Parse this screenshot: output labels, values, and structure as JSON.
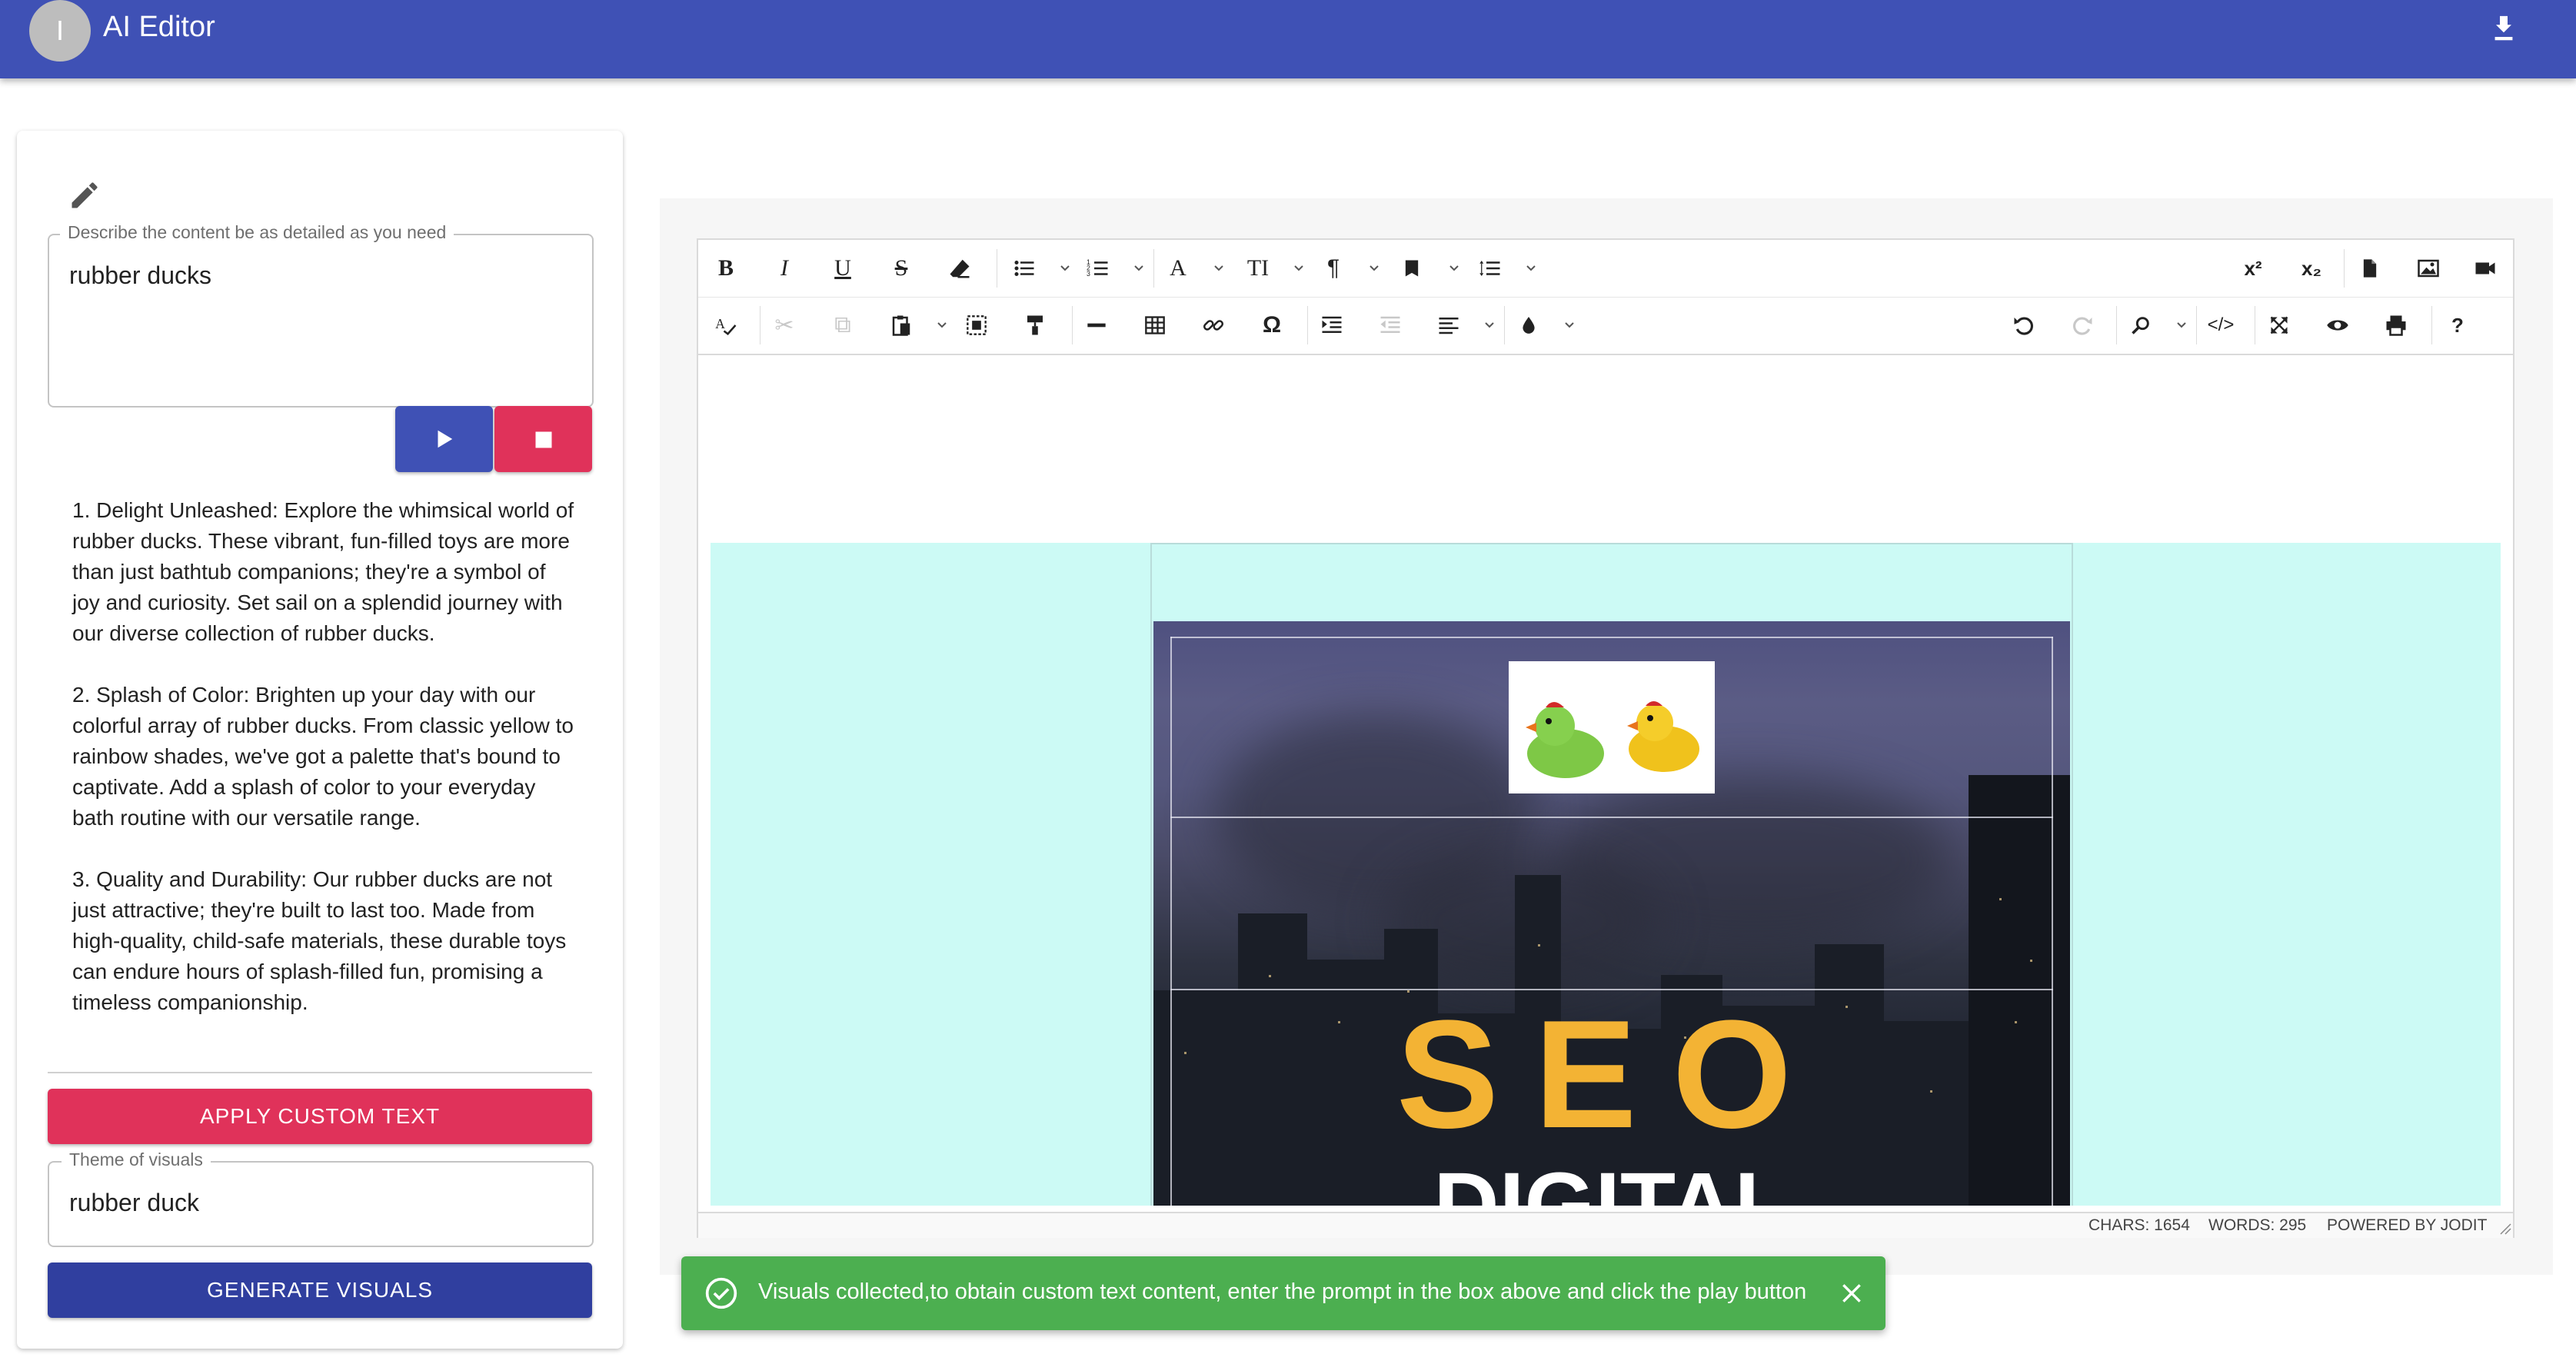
{
  "app": {
    "title": "AI Editor",
    "avatar_letter": "I",
    "download_icon": "download-icon"
  },
  "colors": {
    "appbar": "#3f51b5",
    "primary_button": "#303f9f",
    "danger_button": "#e0325a",
    "snackbar": "#4caf50",
    "editor_content_bg": "#ccfaf5",
    "seo_text": "#f3b334"
  },
  "prompt_field": {
    "label": "Describe the content be as detailed as you need",
    "value": "rubber ducks"
  },
  "controls": {
    "play_icon": "play-icon",
    "stop_icon": "stop-icon"
  },
  "generated_text": {
    "paragraphs": [
      "1. Delight Unleashed: Explore the whimsical world of rubber ducks. These vibrant, fun-filled toys are more than just bathtub companions; they're a symbol of joy and curiosity. Set sail on a splendid journey with our diverse collection of rubber ducks.",
      "2. Splash of Color: Brighten up your day with our colorful array of rubber ducks. From classic yellow to rainbow shades, we've got a palette that's bound to captivate. Add a splash of color to your everyday bath routine with our versatile range.",
      "3. Quality and Durability: Our rubber ducks are not just attractive; they're built to last too. Made from high-quality, child-safe materials, these durable toys can endure hours of splash-filled fun, promising a timeless companionship."
    ]
  },
  "apply_button": {
    "label": "APPLY CUSTOM TEXT"
  },
  "theme_field": {
    "label": "Theme of visuals",
    "value": "rubber duck"
  },
  "generate_button": {
    "label": "GENERATE VISUALS"
  },
  "editor": {
    "toolbar_row1_left": [
      {
        "name": "bold",
        "glyph": "B"
      },
      {
        "name": "italic",
        "glyph": "I"
      },
      {
        "name": "underline",
        "glyph": "U"
      },
      {
        "name": "strikethrough",
        "glyph": "S"
      },
      {
        "name": "eraser",
        "glyph": "⌫"
      },
      {
        "name": "bullet-list",
        "glyph": "☰"
      },
      {
        "name": "numbered-list",
        "glyph": "☰"
      },
      {
        "name": "font",
        "glyph": "A"
      },
      {
        "name": "font-size",
        "glyph": "TI"
      },
      {
        "name": "paragraph",
        "glyph": "¶"
      },
      {
        "name": "classname",
        "glyph": "■"
      },
      {
        "name": "line-height",
        "glyph": "☰"
      }
    ],
    "toolbar_row1_right": [
      {
        "name": "superscript",
        "glyph": "x²"
      },
      {
        "name": "subscript",
        "glyph": "x₂"
      },
      {
        "name": "file",
        "glyph": "📄"
      },
      {
        "name": "image",
        "glyph": "🖼"
      },
      {
        "name": "video",
        "glyph": "🎥"
      }
    ],
    "toolbar_row2_left": [
      {
        "name": "spellcheck",
        "glyph": "A"
      },
      {
        "name": "cut",
        "glyph": "✂"
      },
      {
        "name": "copy",
        "glyph": "⧉"
      },
      {
        "name": "paste",
        "glyph": "📋"
      },
      {
        "name": "select-all",
        "glyph": "⬚"
      },
      {
        "name": "copy-format",
        "glyph": "🖌"
      },
      {
        "name": "horizontal-rule",
        "glyph": "—"
      },
      {
        "name": "table",
        "glyph": "▦"
      },
      {
        "name": "link",
        "glyph": "🔗"
      },
      {
        "name": "symbols",
        "glyph": "Ω"
      },
      {
        "name": "indent",
        "glyph": "⇥"
      },
      {
        "name": "outdent",
        "glyph": "⇤"
      },
      {
        "name": "align",
        "glyph": "≡"
      },
      {
        "name": "brush",
        "glyph": "💧"
      }
    ],
    "toolbar_row2_right": [
      {
        "name": "undo",
        "glyph": "↶"
      },
      {
        "name": "redo",
        "glyph": "↷"
      },
      {
        "name": "find",
        "glyph": "🔍"
      },
      {
        "name": "source",
        "glyph": "</>"
      },
      {
        "name": "fullsize",
        "glyph": "⤢"
      },
      {
        "name": "preview",
        "glyph": "👁"
      },
      {
        "name": "print",
        "glyph": "🖨"
      },
      {
        "name": "about",
        "glyph": "?"
      }
    ],
    "hero": {
      "headline": "SEO",
      "subheadline": "DIGITAL"
    },
    "status": {
      "chars": "CHARS: 1654",
      "words": "WORDS: 295",
      "powered": "POWERED BY JODIT"
    }
  },
  "snackbar": {
    "message": "Visuals collected,to obtain custom text content, enter the prompt in the box above and click the play button",
    "icon": "check-circle-icon",
    "close_icon": "close-icon"
  }
}
